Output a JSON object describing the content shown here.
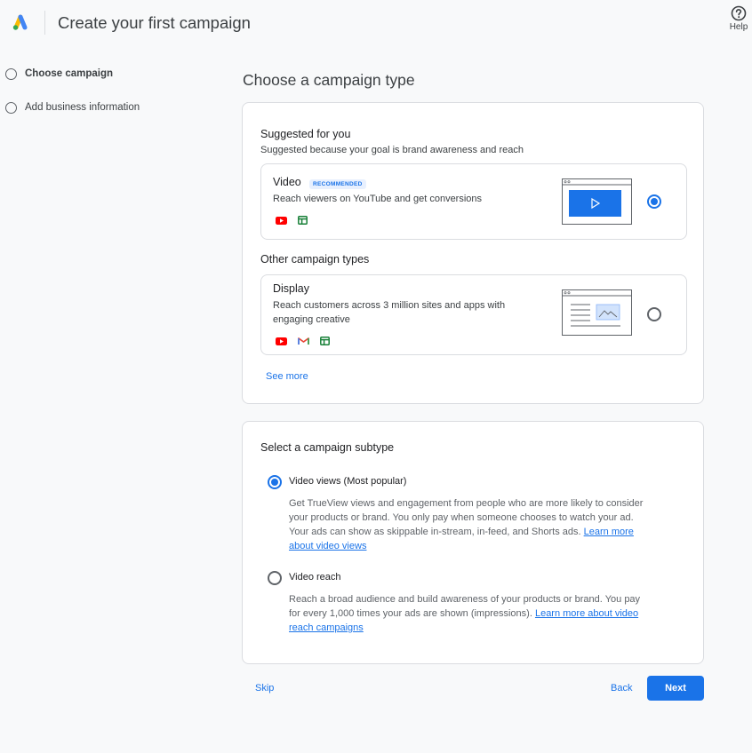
{
  "header": {
    "title": "Create your first campaign",
    "help_label": "Help",
    "logo_icon": "google-ads-logo-icon",
    "help_icon": "help-circle-icon"
  },
  "steps": [
    {
      "label": "Choose campaign",
      "active": true
    },
    {
      "label": "Add business information",
      "active": false
    }
  ],
  "main": {
    "title": "Choose a campaign type",
    "suggested": {
      "heading": "Suggested for you",
      "subtext": "Suggested because your goal is brand awareness and reach"
    },
    "options": {
      "video": {
        "title": "Video",
        "badge": "RECOMMENDED",
        "description": "Reach viewers on YouTube and get conversions",
        "platforms": [
          "youtube-icon",
          "display-network-icon"
        ],
        "selected": true
      },
      "other_heading": "Other campaign types",
      "display": {
        "title": "Display",
        "description": "Reach customers across 3 million sites and apps with engaging creative",
        "platforms": [
          "youtube-icon",
          "gmail-icon",
          "display-network-icon"
        ],
        "selected": false
      },
      "see_more": "See more"
    },
    "subtype": {
      "heading": "Select a campaign subtype",
      "views": {
        "label": "Video views (Most popular)",
        "description": "Get TrueView views and engagement from people who are more likely to consider your products or brand. You only pay when someone chooses to watch your ad. Your ads can show as skippable in-stream, in-feed, and Shorts ads.",
        "link": "Learn more about video views",
        "selected": true
      },
      "reach": {
        "label": "Video reach",
        "description": "Reach a broad audience and build awareness of your products or brand. You pay for every 1,000 times your ads are shown (impressions).",
        "link": "Learn more about video reach campaigns",
        "selected": false
      }
    }
  },
  "footer": {
    "skip": "Skip",
    "back": "Back",
    "next": "Next"
  },
  "colors": {
    "accent": "#1a73e8",
    "youtube": "#ff0000",
    "display": "#188038"
  }
}
